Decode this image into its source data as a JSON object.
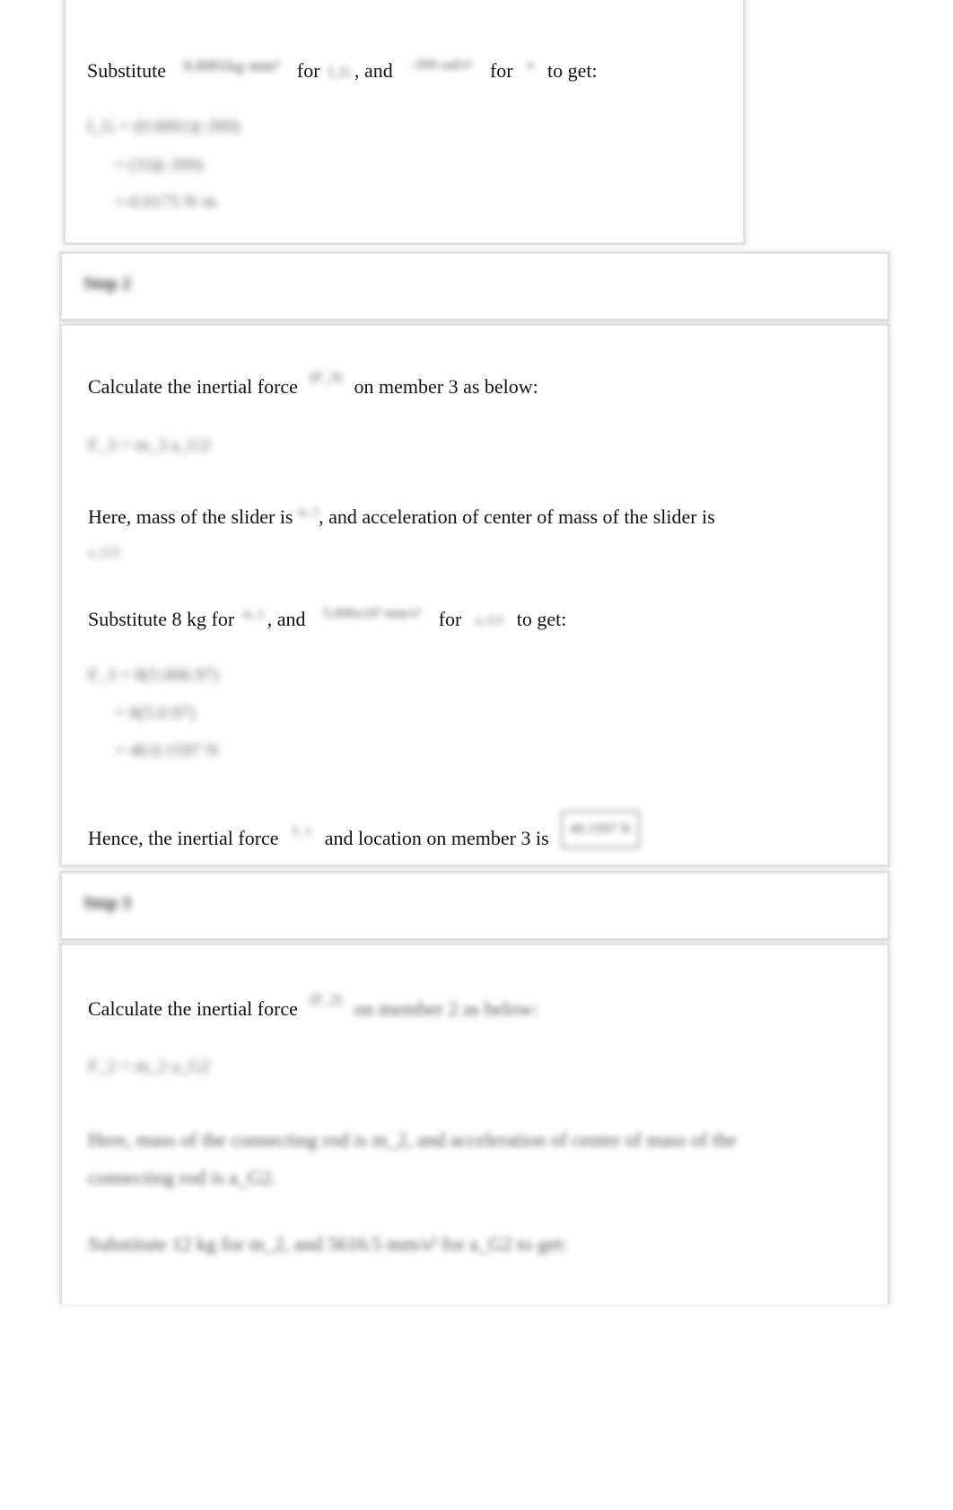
{
  "step1": {
    "substitute_line": {
      "p1": "Substitute",
      "v1": "0.0001kg·mm²",
      "p2": "for",
      "s1": "I_G",
      "p3": ", and",
      "v2": "-399 rad/s²",
      "p4": "for",
      "s2": "α",
      "p5": "to get:"
    },
    "equations": [
      "I_G = (0.0001)(-399)",
      "= (33)(-399)",
      "=-0.0175 N·m"
    ]
  },
  "step2": {
    "header": "Step 2",
    "calc": {
      "p1": "Calculate the inertial force",
      "sym": "(F_3)",
      "p2": "on member 3 as below:"
    },
    "formula": "F_3 = m_3 a_G3",
    "here": {
      "p1": "Here, mass of the slider is",
      "sym1": "m_3",
      "p2": ", and acceleration of center of mass of the slider is",
      "sym2": "a_G3"
    },
    "substitute": {
      "p1": "Substitute 8 kg for",
      "sym1": "m_3",
      "p2": ", and",
      "v1": "5.006x10³ mm/s²",
      "p3": "for",
      "sym2": "a_G3",
      "p4": "to get:"
    },
    "equations": [
      "F_3 = 8(5.006.97)",
      "= 8(5.0.97)",
      "= 40.0.1597 N"
    ],
    "hence": {
      "p1": "Hence, the inertial force",
      "sym": "F_3",
      "p2": "and location on member 3 is",
      "result": "40.1597 N"
    }
  },
  "step3": {
    "header": "Step 3",
    "calc": {
      "p1": "Calculate the inertial force",
      "sym": "(F_2)",
      "p2": "on member 2 as below:"
    },
    "formula": "F_2 = m_2 a_G2",
    "here": {
      "line1": "Here, mass of the connecting rod is m_2, and acceleration of center of mass of the",
      "line2": "connecting rod is a_G2."
    },
    "substitute": "Substitute 12 kg for m_2, and 5616.5 mm/s² for a_G2 to get:"
  }
}
